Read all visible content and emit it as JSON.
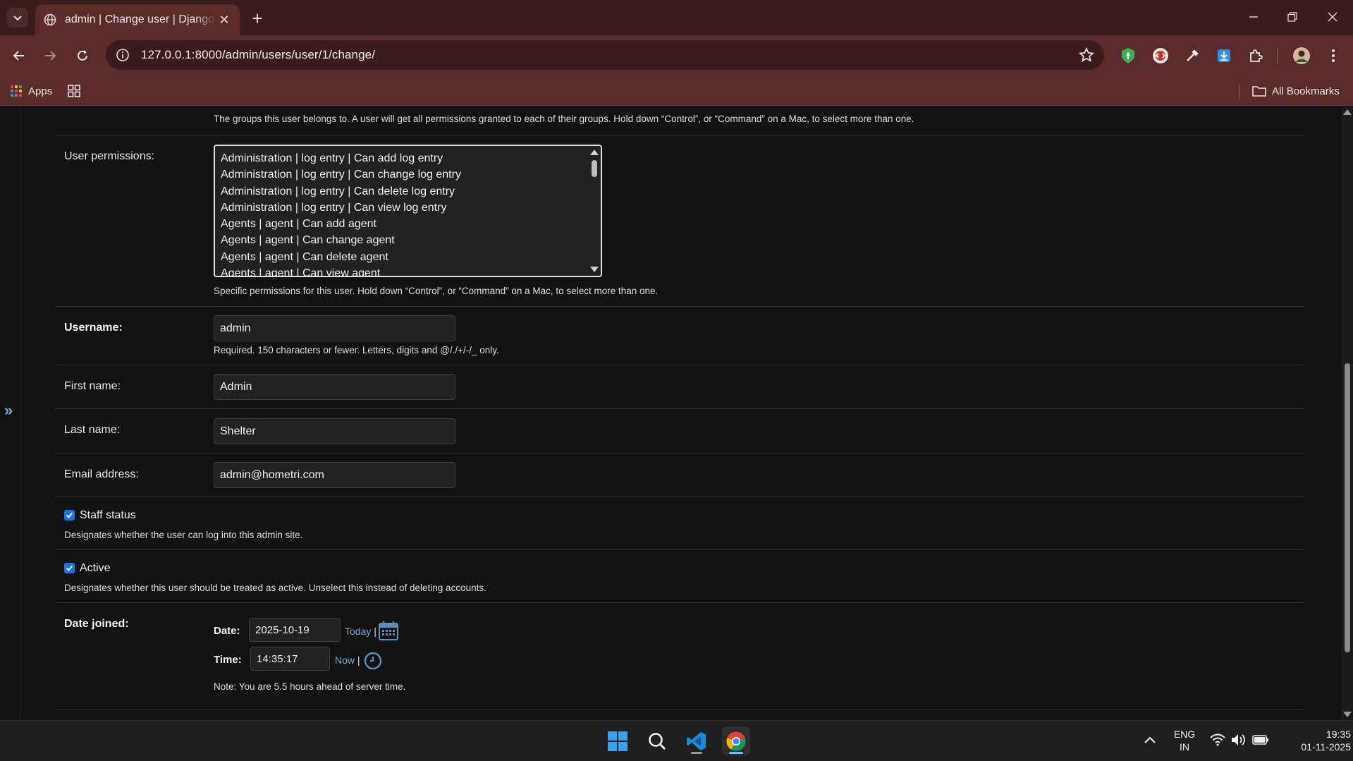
{
  "browser": {
    "tab_title": "admin | Change user | Django site admin",
    "close_symbol": "✕",
    "new_tab_symbol": "+",
    "url": "127.0.0.1:8000/admin/users/user/1/change/",
    "bookmarks": {
      "apps_label": "Apps",
      "all_bookmarks_label": "All Bookmarks"
    }
  },
  "form": {
    "groups_help": "The groups this user belongs to. A user will get all permissions granted to each of their groups. Hold down “Control”, or “Command” on a Mac, to select more than one.",
    "user_permissions": {
      "label": "User permissions:",
      "options": [
        "Administration | log entry | Can add log entry",
        "Administration | log entry | Can change log entry",
        "Administration | log entry | Can delete log entry",
        "Administration | log entry | Can view log entry",
        "Agents | agent | Can add agent",
        "Agents | agent | Can change agent",
        "Agents | agent | Can delete agent",
        "Agents | agent | Can view agent"
      ],
      "help": "Specific permissions for this user. Hold down “Control”, or “Command” on a Mac, to select more than one."
    },
    "username": {
      "label": "Username:",
      "value": "admin",
      "help": "Required. 150 characters or fewer. Letters, digits and @/./+/-/_ only."
    },
    "first_name": {
      "label": "First name:",
      "value": "Admin"
    },
    "last_name": {
      "label": "Last name:",
      "value": "Shelter"
    },
    "email": {
      "label": "Email address:",
      "value": "admin@hometri.com"
    },
    "staff_status": {
      "label": "Staff status",
      "checked": true,
      "help": "Designates whether the user can log into this admin site."
    },
    "active": {
      "label": "Active",
      "checked": true,
      "help": "Designates whether this user should be treated as active. Unselect this instead of deleting accounts."
    },
    "date_joined": {
      "label": "Date joined:",
      "date_label": "Date:",
      "date_value": "2025-10-19",
      "today_link": "Today",
      "time_label": "Time:",
      "time_value": "14:35:17",
      "now_link": "Now",
      "separator": "|",
      "note": "Note: You are 5.5 hours ahead of server time."
    }
  },
  "sidebar_toggle": "»",
  "taskbar": {
    "language": "ENG",
    "region": "IN",
    "time": "19:35",
    "date": "01-11-2025"
  },
  "colors": {
    "tab_strip": "#3b1c1c",
    "toolbar": "#5a2b2b",
    "page_bg": "#121212",
    "link": "#79aec8",
    "checkbox": "#1a73e8"
  }
}
